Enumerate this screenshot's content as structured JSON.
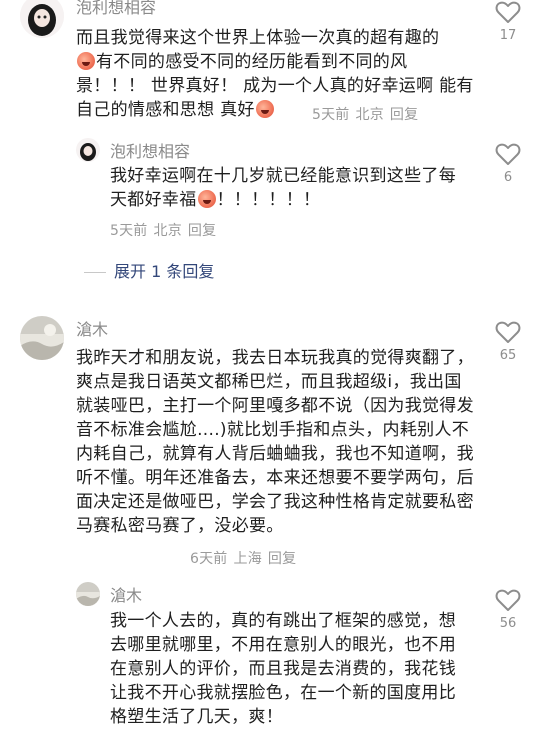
{
  "comments": [
    {
      "username": "泡利想相容",
      "text_parts": [
        "而且我觉得来这个世界上体验一次真的超有趣的",
        "有不同的感受不同的经历能看到不同的风景！！！ 世界真好！ 成为一个人真的好幸运啊 能有自己的情感和思想 真好"
      ],
      "time": "5天前",
      "location": "北京",
      "reply_label": "回复",
      "likes": "17"
    },
    {
      "username": "泡利想相容",
      "text_parts": [
        "我好幸运啊在十几岁就已经能意识到这些了每天都好幸福",
        "！！！！！！"
      ],
      "time": "5天前",
      "location": "北京",
      "reply_label": "回复",
      "likes": "6"
    },
    {
      "username": "滄木",
      "text": "我昨天才和朋友说，我去日本玩我真的觉得爽翻了，爽点是我日语英文都稀巴烂，而且我超级i，我出国就装哑巴，主打一个阿里嘎多都不说（因为我觉得发音不标准会尴尬....)就比划手指和点头，内耗别人不内耗自己，就算有人背后蛐蛐我，我也不知道啊，我听不懂。明年还准备去，本来还想要不要学两句，后面决定还是做哑巴，学会了我这种性格肯定就要私密马赛私密马赛了，没必要。",
      "time": "6天前",
      "location": "上海",
      "reply_label": "回复",
      "likes": "65"
    },
    {
      "username": "滄木",
      "text": "我一个人去的，真的有跳出了框架的感觉，想去哪里就哪里，不用在意别人的眼光，也不用在意别人的评价，而且我是去消费的，我花钱让我不开心我就摆脸色，在一个新的国度用比格塑生活了几天，爽！",
      "likes": "56"
    }
  ],
  "expand_replies": "展开 1 条回复",
  "colors": {
    "link": "#33477a",
    "meta": "#9a9a9a",
    "heart": "#8d8d8d"
  },
  "icons": {
    "like": "heart-outline-icon",
    "emoji": "laughing-face-emoji"
  }
}
